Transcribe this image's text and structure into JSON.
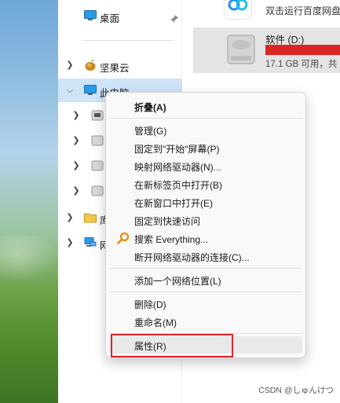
{
  "nav": {
    "items": [
      {
        "label": "桌面",
        "icon": "desktop-icon",
        "pinned": true
      },
      {
        "label": "坚果云",
        "icon": "nutstore-icon"
      },
      {
        "label": "此电脑",
        "icon": "this-pc-icon",
        "selected": true
      },
      {
        "label": "",
        "icon": "drive-icon"
      },
      {
        "label": "",
        "icon": "drive-icon"
      },
      {
        "label": "",
        "icon": "drive-icon"
      },
      {
        "label": "",
        "icon": "drive-icon"
      },
      {
        "label": "库",
        "icon": "folder-icon"
      },
      {
        "label": "网",
        "icon": "network-icon"
      }
    ]
  },
  "content": {
    "app_label": "双击运行百度网盘",
    "drive": {
      "name": "软件 (D:)",
      "used_fraction": 0.97,
      "free_text": "17.1 GB 可用，共"
    }
  },
  "menu": {
    "items": [
      {
        "label": "折叠(A)",
        "bold": true
      },
      {
        "label": "管理(G)"
      },
      {
        "label": "固定到\"开始\"屏幕(P)"
      },
      {
        "label": "映射网络驱动器(N)..."
      },
      {
        "label": "在新标签页中打开(B)"
      },
      {
        "label": "在新窗口中打开(E)"
      },
      {
        "label": "固定到快速访问"
      },
      {
        "label": "搜索 Everything...",
        "icon": "search-everything-icon"
      },
      {
        "label": "断开网络驱动器的连接(C)..."
      },
      {
        "label": "添加一个网络位置(L)"
      },
      {
        "label": "删除(D)"
      },
      {
        "label": "重命名(M)"
      },
      {
        "label": "属性(R)",
        "highlighted": true
      }
    ]
  },
  "colors": {
    "selection": "#cfe4f7",
    "drive_bar": "#da2626",
    "highlight_border": "#d9262c"
  },
  "watermark": "CSDN @しゅんけつ"
}
